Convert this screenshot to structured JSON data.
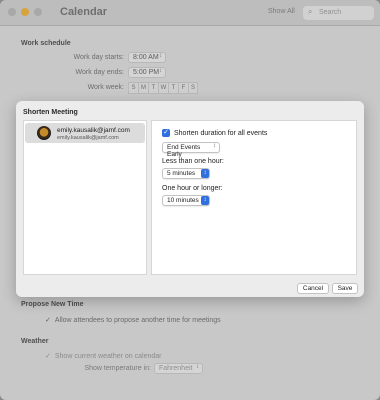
{
  "window": {
    "title": "Calendar",
    "show_all": "Show All",
    "search_placeholder": "Search"
  },
  "work_schedule": {
    "title": "Work schedule",
    "starts_label": "Work day starts:",
    "starts_value": "8:00 AM",
    "ends_label": "Work day ends:",
    "ends_value": "5:00 PM",
    "week_label": "Work week:",
    "days": [
      "S",
      "M",
      "T",
      "W",
      "T",
      "F",
      "S"
    ]
  },
  "sheet": {
    "title": "Shorten Meeting",
    "account": {
      "name": "emily.kausalik@jamf.com",
      "email": "emily.kausalik@jamf.com"
    },
    "shorten_checkbox_label": "Shorten duration for all events",
    "shorten_checked": true,
    "mode_value": "End Events Early",
    "less_than_hour_label": "Less than one hour:",
    "less_than_hour_value": "5 minutes",
    "hour_or_longer_label": "One hour or longer:",
    "hour_or_longer_value": "10 minutes",
    "cancel_label": "Cancel",
    "save_label": "Save"
  },
  "propose": {
    "title": "Propose New Time",
    "checkbox_label": "Allow attendees to propose another time for meetings"
  },
  "weather": {
    "title": "Weather",
    "checkbox_label": "Show current weather on calendar",
    "temp_label": "Show temperature in:",
    "temp_value": "Fahrenheit"
  },
  "colors": {
    "accent": "#2f6fde"
  }
}
